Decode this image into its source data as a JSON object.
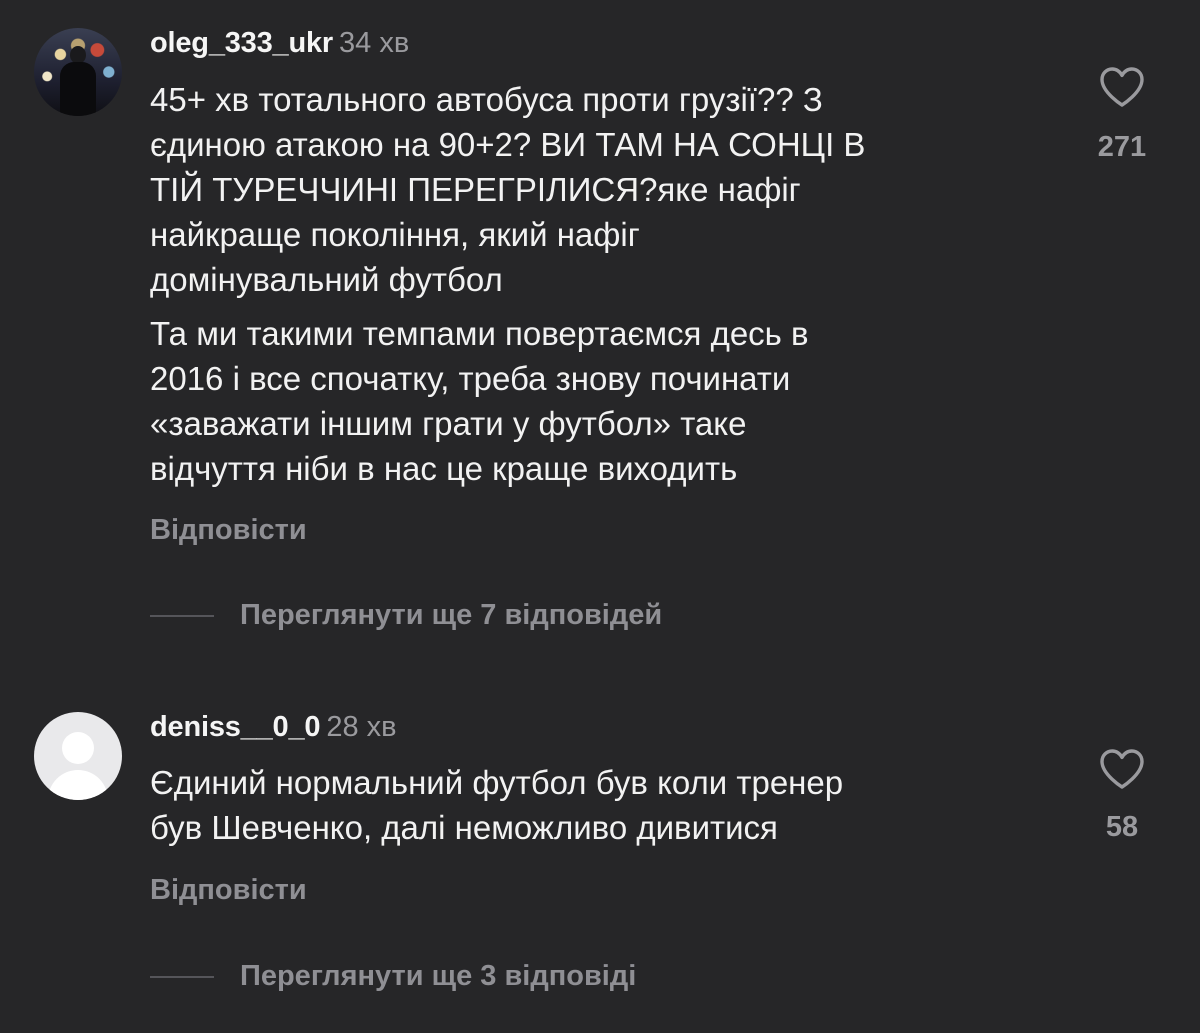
{
  "comments": [
    {
      "username": "oleg_333_ukr",
      "time": "34 хв",
      "avatar": "photo-avatar",
      "paragraphs": [
        [
          "45+ хв тотального автобуса проти  грузії?? З",
          "єдиною атакою на 90+2? ВИ ТАМ НА СОНЦІ В",
          "ТІЙ ТУРЕЧЧИНІ ПЕРЕГРІЛИСЯ?яке нафіг",
          "найкраще покоління, який нафіг",
          "домінувальний футбол"
        ],
        [
          "Та ми такими темпами повертаємся десь в",
          "2016 і все спочатку, треба знову починати",
          "«заважати іншим грати у футбол» таке",
          "відчуття ніби в нас це краще виходить"
        ]
      ],
      "reply_label": "Відповісти",
      "view_replies_label": "Переглянути ще 7 відповідей",
      "likes": "271",
      "like_icon": "heart-outline-icon"
    },
    {
      "username": "deniss__0_0",
      "time": "28 хв",
      "avatar": "default-avatar",
      "paragraphs": [
        [
          "Єдиний нормальний футбол був коли тренер",
          "був Шевченко, далі неможливо дивитися"
        ]
      ],
      "reply_label": "Відповісти",
      "view_replies_label": "Переглянути ще 3 відповіді",
      "likes": "58",
      "like_icon": "heart-outline-icon"
    }
  ],
  "colors": {
    "background": "#262628",
    "primary_text": "#f2f2f2",
    "secondary_text": "#8f8f94"
  }
}
